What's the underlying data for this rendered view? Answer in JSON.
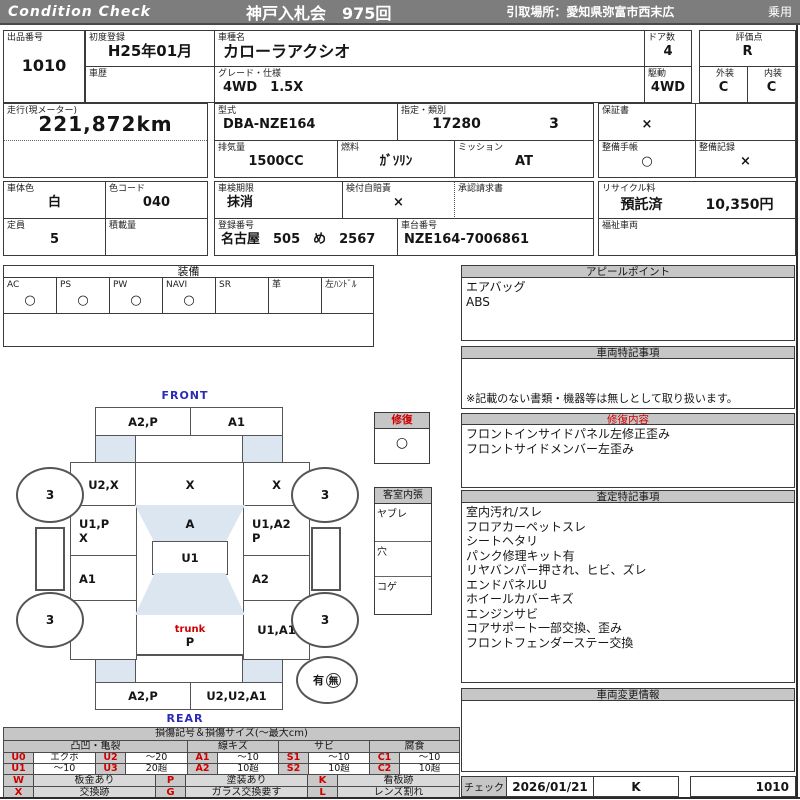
{
  "colors": {
    "header_bar": "#7d7d7d",
    "section_header": "#c6c6c6",
    "glass_fill": "#dce6f1",
    "accent_red": "#cf0000",
    "accent_blue": "#2b2bb5"
  },
  "header": {
    "brand": "Condition  Check",
    "auction": "神戸入札会　975回",
    "pickup": "引取場所：愛知県弥富市西末広",
    "category": "乗用"
  },
  "info": {
    "lot": {
      "label": "出品番号",
      "value": "1010"
    },
    "first_reg": {
      "label": "初度登録",
      "value": "H25年01月"
    },
    "history": {
      "label": "車歴",
      "value": ""
    },
    "model_name": {
      "label": "車種名",
      "value": "カローラアクシオ"
    },
    "grade": {
      "label": "グレード・仕様",
      "value": "4WD　1.5X"
    },
    "doors": {
      "label": "ドア数",
      "value": "4"
    },
    "drive": {
      "label": "駆動",
      "value": "4WD"
    },
    "score": {
      "label": "評価点",
      "value": "R"
    },
    "exterior": {
      "label": "外装",
      "value": "C"
    },
    "interior": {
      "label": "内装",
      "value": "C"
    },
    "mileage": {
      "label": "走行(現メーター)",
      "value": "221,872km"
    },
    "model_code": {
      "label": "型式",
      "value": "DBA-NZE164"
    },
    "class_no": {
      "label": "指定・類別",
      "value": "17280",
      "value2": "3"
    },
    "displacement": {
      "label": "排気量",
      "value": "1500CC"
    },
    "fuel": {
      "label": "燃料",
      "value": "ｶﾞｿﾘﾝ"
    },
    "transmission": {
      "label": "ミッション",
      "value": "AT"
    },
    "warranty": {
      "label": "保証書",
      "value": "×"
    },
    "maintenance_book": {
      "label": "整備手帳",
      "value": "○"
    },
    "maintenance_record": {
      "label": "整備記録",
      "value": "×"
    },
    "body_color": {
      "label": "車体色",
      "value": "白"
    },
    "color_code": {
      "label": "色コード",
      "value": "040"
    },
    "capacity": {
      "label": "定員",
      "value": "5"
    },
    "load": {
      "label": "積載量",
      "value": ""
    },
    "inspection": {
      "label": "車検期限",
      "value": "抹消"
    },
    "insurance": {
      "label": "検付自賠責",
      "value": "×"
    },
    "approval": {
      "label": "承認請求書",
      "value": ""
    },
    "reg_number": {
      "label": "登録番号",
      "value": "名古屋　505　め　2567"
    },
    "chassis_no": {
      "label": "車台番号",
      "value": "NZE164-7006861"
    },
    "recycle": {
      "label": "リサイクル料",
      "value": "預託済",
      "amount": "10,350円"
    },
    "welfare": {
      "label": "福祉車両",
      "value": ""
    }
  },
  "equipment": {
    "title": "装備",
    "items": [
      {
        "label": "AC",
        "value": "○"
      },
      {
        "label": "PS",
        "value": "○"
      },
      {
        "label": "PW",
        "value": "○"
      },
      {
        "label": "NAVI",
        "value": "○"
      },
      {
        "label": "SR",
        "value": ""
      },
      {
        "label": "革",
        "value": ""
      },
      {
        "label": "左ﾊﾝﾄﾞﾙ",
        "value": ""
      }
    ]
  },
  "sections": {
    "appeal": {
      "title": "アピールポイント",
      "lines": [
        "エアバッグ",
        "ABS"
      ]
    },
    "vehicle_notes": {
      "title": "車両特記事項",
      "note": "※記載のない書類・機器等は無しとして取り扱います。"
    },
    "repair": {
      "title": "修復内容",
      "lines": [
        "フロントインサイドパネル左修正歪み",
        "フロントサイドメンバー左歪み"
      ]
    },
    "assessment": {
      "title": "査定特記事項",
      "lines": [
        "室内汚れ/スレ",
        "フロアカーペットスレ",
        "シートヘタリ",
        "パンク修理キット有",
        "リヤバンパー押され、ヒビ、ズレ",
        "エンドパネルU",
        "ホイールカバーキズ",
        "エンジンサビ",
        "コアサポート一部交換、歪み",
        "フロントフェンダーステー交換"
      ]
    },
    "changes": {
      "title": "車両変更情報"
    }
  },
  "diagram": {
    "front_label": "FRONT",
    "rear_label": "REAR",
    "front_bumper_left": "A2,P",
    "front_bumper_right": "A1",
    "fender_left": "U2,X",
    "hood": "X",
    "fender_right": "X",
    "door_left_1a": "U1,P",
    "door_left_1b": "X",
    "door_left_2": "A1",
    "windshield": "A",
    "roof": "U1",
    "door_right_1a": "U1,A2",
    "door_right_1b": "P",
    "door_right_2": "A2",
    "trunk_label": "trunk",
    "trunk_value": "P",
    "quarter_right": "U1,A1",
    "rear_bumper_left": "A2,P",
    "rear_bumper_right": "U2,U2,A1",
    "tire_front_left": "3",
    "tire_front_right": "3",
    "tire_rear_left": "3",
    "tire_rear_right": "3",
    "spare_yes": "有",
    "spare_no": "無",
    "repair_box": {
      "title": "修復",
      "value": "○"
    },
    "interior_box": {
      "title": "客室内張",
      "rows": [
        "ヤブレ",
        "穴",
        "コゲ"
      ]
    }
  },
  "legend": {
    "title": "損傷記号＆損傷サイズ(〜最大cm)",
    "groups": [
      "凸凹・亀裂",
      "線キズ",
      "サビ",
      "腐食"
    ],
    "row1": [
      "U0",
      "エクボ",
      "U2",
      "〜20",
      "A1",
      "〜10",
      "S1",
      "〜10",
      "C1",
      "〜10"
    ],
    "row2": [
      "U1",
      "〜10",
      "U3",
      "20超",
      "A2",
      "10超",
      "S2",
      "10超",
      "C2",
      "10超"
    ],
    "marks_row1": [
      "W",
      "板金あり",
      "P",
      "塗装あり",
      "K",
      "看板跡"
    ],
    "marks_row2": [
      "X",
      "交換跡",
      "G",
      "ガラス交換要す",
      "L",
      "レンズ割れ"
    ]
  },
  "check": {
    "label": "チェック",
    "date": "2026/01/21",
    "inspector": "K",
    "lot": "1010"
  }
}
